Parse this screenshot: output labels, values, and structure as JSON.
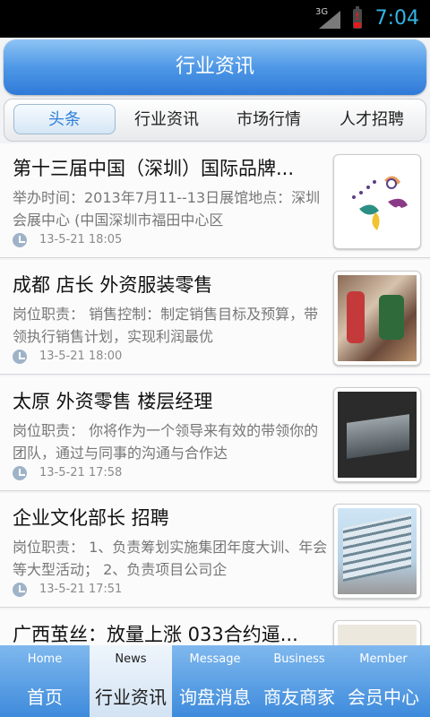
{
  "status_bar": {
    "network": "3G",
    "time": "7:04",
    "battery_alert": "!"
  },
  "header": {
    "title": "行业资讯"
  },
  "tabs": [
    {
      "label": "头条",
      "active": true
    },
    {
      "label": "行业资讯",
      "active": false
    },
    {
      "label": "市场行情",
      "active": false
    },
    {
      "label": "人才招聘",
      "active": false
    }
  ],
  "news": [
    {
      "title": "第十三届中国（深圳）国际品牌...",
      "desc": "举办时间：2013年7月11--13日展馆地点：深圳会展中心 (中国深圳市福田中心区",
      "time": "13-5-21 18:05",
      "thumb": "logo-thumbnail"
    },
    {
      "title": "成都 店长 外资服装零售",
      "desc": "岗位职责： 销售控制：制定销售目标及预算，带领执行销售计划，实现利润最优",
      "time": "13-5-21 18:00",
      "thumb": "store-thumbnail"
    },
    {
      "title": "太原 外资零售 楼层经理",
      "desc": "岗位职责： 你将作为一个领导来有效的带领你的团队，通过与同事的沟通与合作达",
      "time": "13-5-21 17:58",
      "thumb": "gallery-thumbnail"
    },
    {
      "title": "企业文化部长 招聘",
      "desc": "岗位职责： 1、负责筹划实施集团年度大训、年会等大型活动； 2、负责项目公司企",
      "time": "13-5-21 17:51",
      "thumb": "building-thumbnail"
    },
    {
      "title": "广西茧丝：放量上涨 033合约逼...",
      "desc": "",
      "time": "",
      "thumb": "cocoon-thumbnail"
    }
  ],
  "bottom_nav": [
    {
      "en": "Home",
      "cn": "首页",
      "active": false
    },
    {
      "en": "News",
      "cn": "行业资讯",
      "active": true
    },
    {
      "en": "Message",
      "cn": "询盘消息",
      "active": false
    },
    {
      "en": "Business",
      "cn": "商友商家",
      "active": false
    },
    {
      "en": "Member",
      "cn": "会员中心",
      "active": false
    }
  ],
  "colors": {
    "accent": "#2f7ad9",
    "status_time": "#33b5e5",
    "battery_alert": "#e21b1b"
  }
}
